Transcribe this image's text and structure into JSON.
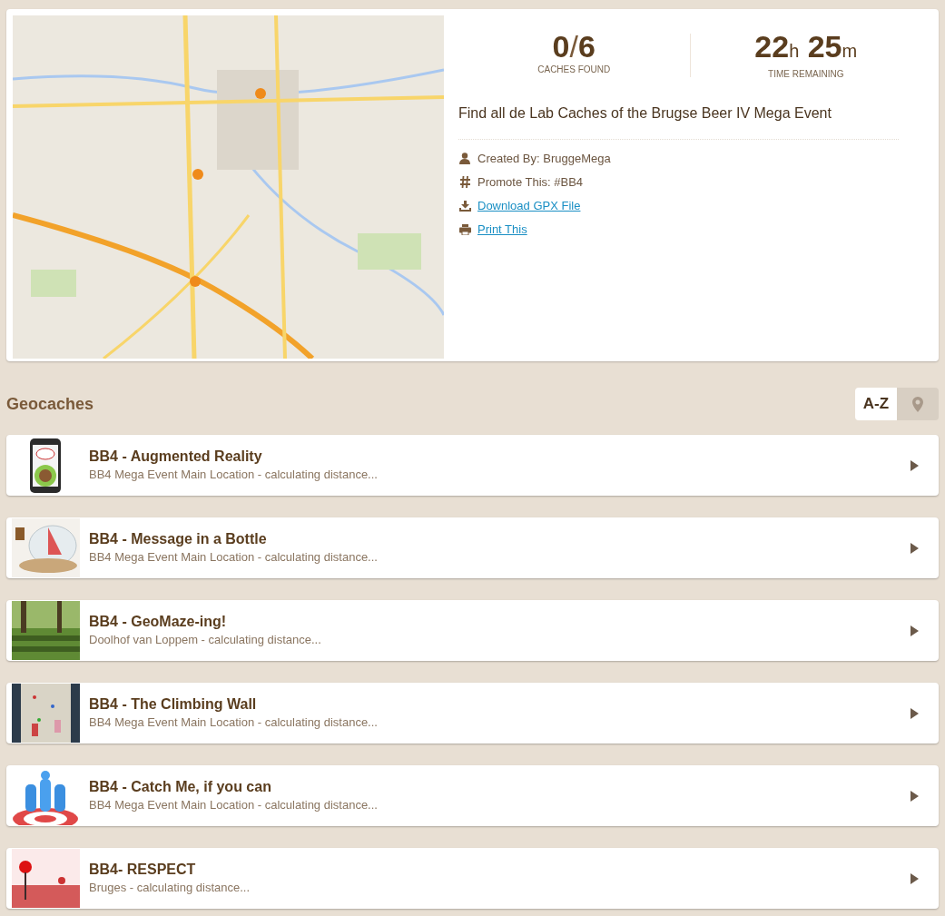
{
  "summary": {
    "found": "0",
    "found_sep": "/",
    "total": "6",
    "found_label": "CACHES FOUND",
    "hours": "22",
    "hours_unit": "h",
    "minutes": "25",
    "minutes_unit": "m",
    "time_label": "TIME REMAINING"
  },
  "description": "Find all de Lab Caches of the Brugse Beer IV Mega Event",
  "details": [
    {
      "kind": "author",
      "text": "Created By: BruggeMega"
    },
    {
      "kind": "promotion",
      "text": "Promote This: #BB4"
    },
    {
      "kind": "download",
      "text": "Download GPX File"
    },
    {
      "kind": "print",
      "text": "Print This"
    }
  ],
  "section_title": "Geocaches",
  "sort_buttons": [
    {
      "kind": "text",
      "label": "A-Z",
      "selected": true
    },
    {
      "kind": "pin",
      "selected": false
    }
  ],
  "geocaches": [
    {
      "title": "BB4 - Augmented Reality",
      "subtitle": "BB4 Mega Event Main Location - calculating distance..."
    },
    {
      "title": "BB4 - Message in a Bottle",
      "subtitle": "BB4 Mega Event Main Location - calculating distance..."
    },
    {
      "title": "BB4 - GeoMaze-ing!",
      "subtitle": "Doolhof van Loppem - calculating distance..."
    },
    {
      "title": "BB4 - The Climbing Wall",
      "subtitle": "BB4 Mega Event Main Location - calculating distance..."
    },
    {
      "title": "BB4 - Catch Me, if you can",
      "subtitle": "BB4 Mega Event Main Location - calculating distance..."
    },
    {
      "title": "BB4- RESPECT",
      "subtitle": "Bruges - calculating distance..."
    }
  ]
}
